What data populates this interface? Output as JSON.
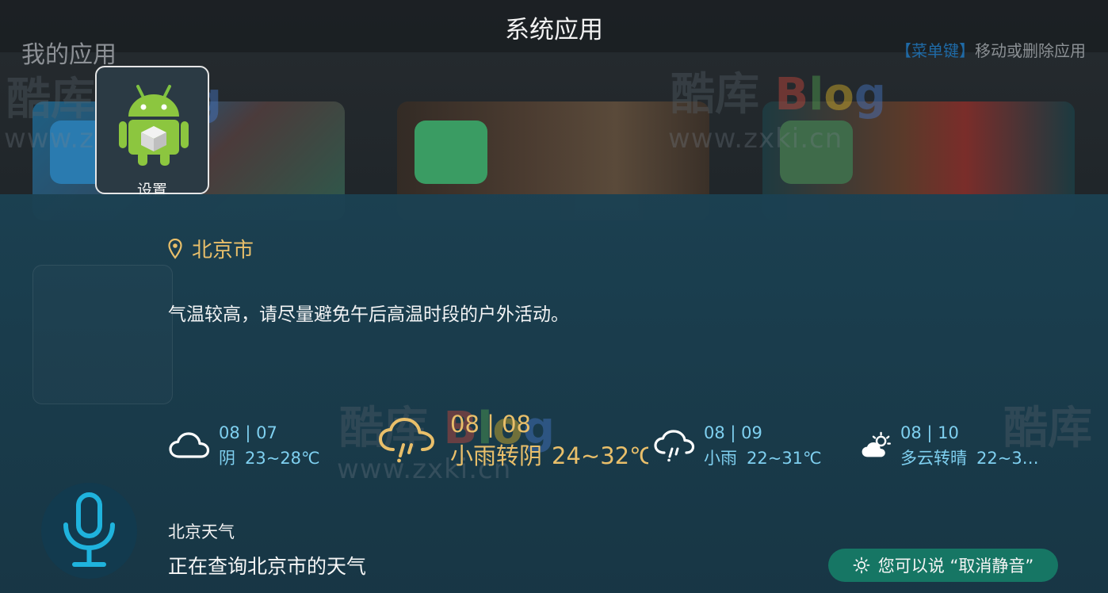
{
  "header": {
    "title": "系统应用"
  },
  "launcher": {
    "section_title": "我的应用",
    "menu_hint_key": "【菜单键】",
    "menu_hint_text": "移动或删除应用",
    "selected_app_label": "设置"
  },
  "watermark": {
    "name": "酷库",
    "brand": [
      "B",
      "l",
      "o",
      "g"
    ],
    "url": "www.zxki.cn"
  },
  "weather": {
    "city": "北京市",
    "advice": "气温较高，请尽量避免午后高温时段的户外活动。",
    "days": [
      {
        "date": "08 | 07",
        "condition": "阴",
        "temp": "23~28℃",
        "icon": "cloud-icon"
      },
      {
        "date": "08 | 08",
        "condition": "小雨转阴",
        "temp": "24~32℃",
        "icon": "cloud-rain-icon",
        "selected": true
      },
      {
        "date": "08 | 09",
        "condition": "小雨",
        "temp": "22~31℃",
        "icon": "cloud-rain-icon"
      },
      {
        "date": "08 | 10",
        "condition": "多云转晴",
        "temp": "22~3…",
        "icon": "partly-sunny-icon"
      }
    ]
  },
  "voice": {
    "query": "北京天气",
    "status": "正在查询北京市的天气",
    "hint": "您可以说 “取消静音”",
    "icon": "microphone-icon"
  },
  "colors": {
    "accent": "#e9bf6a",
    "info": "#7fd0f0",
    "pill": "#167664",
    "mic": "#1fb3dd"
  }
}
